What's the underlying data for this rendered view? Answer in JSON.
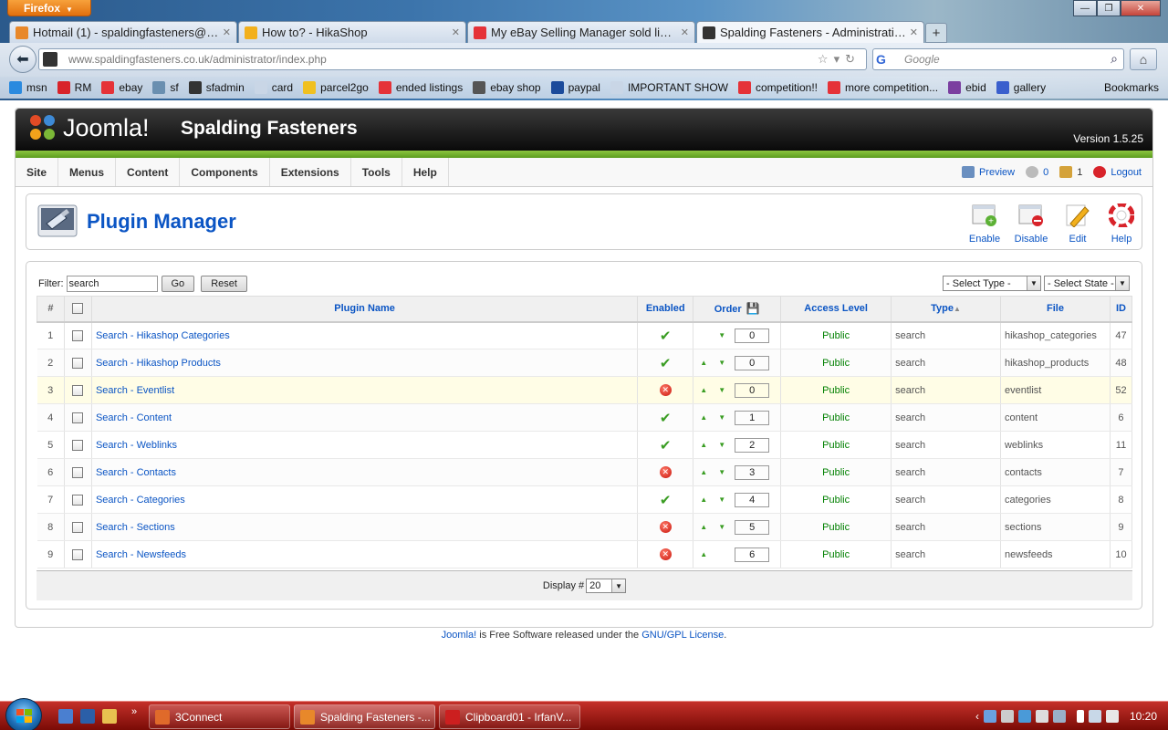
{
  "browser": {
    "app_button": "Firefox",
    "tabs": [
      {
        "title": "Hotmail (1) - spaldingfasteners@hot...",
        "icon_color": "#e8882a",
        "active": false
      },
      {
        "title": "How to? - HikaShop",
        "icon_color": "#f2b01c",
        "active": false
      },
      {
        "title": "My eBay Selling Manager sold listings...",
        "icon_color": "#e53238",
        "active": false
      },
      {
        "title": "Spalding Fasteners - Administration",
        "icon_color": "#333333",
        "active": true
      }
    ],
    "url_host": "www.spaldingfasteners.co.uk",
    "url_path": "/administrator/index.php",
    "search_engine_icon": "G",
    "search_placeholder": "Google",
    "bookmarks": [
      {
        "label": "msn",
        "icon_color": "#2a8adf"
      },
      {
        "label": "RM",
        "icon_color": "#d8232a"
      },
      {
        "label": "ebay",
        "icon_color": "#e53238"
      },
      {
        "label": "sf",
        "icon_color": "#6a8fb0"
      },
      {
        "label": "sfadmin",
        "icon_color": "#333333"
      },
      {
        "label": "card",
        "icon_color": "#c9d6e6"
      },
      {
        "label": "parcel2go",
        "icon_color": "#f0c020"
      },
      {
        "label": "ended listings",
        "icon_color": "#e53238"
      },
      {
        "label": "ebay shop",
        "icon_color": "#555555"
      },
      {
        "label": "paypal",
        "icon_color": "#1c4b9b"
      },
      {
        "label": "IMPORTANT SHOW",
        "icon_color": "#c9d6e6"
      },
      {
        "label": "competition!!",
        "icon_color": "#e53238"
      },
      {
        "label": "more competition...",
        "icon_color": "#e53238"
      },
      {
        "label": "ebid",
        "icon_color": "#7b3fa0"
      },
      {
        "label": "gallery",
        "icon_color": "#3a5fcd"
      }
    ],
    "bookmarks_menu": "Bookmarks"
  },
  "joomla": {
    "logo_text": "Joomla!",
    "site_name": "Spalding Fasteners",
    "version": "Version 1.5.25",
    "menu": [
      "Site",
      "Menus",
      "Content",
      "Components",
      "Extensions",
      "Tools",
      "Help"
    ],
    "status": {
      "preview": "Preview",
      "messages": "0",
      "users": "1",
      "logout": "Logout"
    },
    "page_title": "Plugin Manager",
    "toolbar": {
      "enable": "Enable",
      "disable": "Disable",
      "edit": "Edit",
      "help": "Help"
    },
    "filter": {
      "label": "Filter:",
      "value": "search",
      "go": "Go",
      "reset": "Reset",
      "type_select": "- Select Type -",
      "state_select": "- Select State -"
    },
    "table": {
      "headers": {
        "num": "#",
        "name": "Plugin Name",
        "enabled": "Enabled",
        "order": "Order",
        "access": "Access Level",
        "type": "Type",
        "file": "File",
        "id": "ID"
      },
      "rows": [
        {
          "num": "1",
          "name": "Search - Hikashop Categories",
          "enabled": true,
          "up": false,
          "down": true,
          "order": "0",
          "access": "Public",
          "type": "search",
          "file": "hikashop_categories",
          "id": "47"
        },
        {
          "num": "2",
          "name": "Search - Hikashop Products",
          "enabled": true,
          "up": true,
          "down": true,
          "order": "0",
          "access": "Public",
          "type": "search",
          "file": "hikashop_products",
          "id": "48"
        },
        {
          "num": "3",
          "name": "Search - Eventlist",
          "enabled": false,
          "up": true,
          "down": true,
          "order": "0",
          "access": "Public",
          "type": "search",
          "file": "eventlist",
          "id": "52"
        },
        {
          "num": "4",
          "name": "Search - Content",
          "enabled": true,
          "up": true,
          "down": true,
          "order": "1",
          "access": "Public",
          "type": "search",
          "file": "content",
          "id": "6"
        },
        {
          "num": "5",
          "name": "Search - Weblinks",
          "enabled": true,
          "up": true,
          "down": true,
          "order": "2",
          "access": "Public",
          "type": "search",
          "file": "weblinks",
          "id": "11"
        },
        {
          "num": "6",
          "name": "Search - Contacts",
          "enabled": false,
          "up": true,
          "down": true,
          "order": "3",
          "access": "Public",
          "type": "search",
          "file": "contacts",
          "id": "7"
        },
        {
          "num": "7",
          "name": "Search - Categories",
          "enabled": true,
          "up": true,
          "down": true,
          "order": "4",
          "access": "Public",
          "type": "search",
          "file": "categories",
          "id": "8"
        },
        {
          "num": "8",
          "name": "Search - Sections",
          "enabled": false,
          "up": true,
          "down": true,
          "order": "5",
          "access": "Public",
          "type": "search",
          "file": "sections",
          "id": "9"
        },
        {
          "num": "9",
          "name": "Search - Newsfeeds",
          "enabled": false,
          "up": true,
          "down": false,
          "order": "6",
          "access": "Public",
          "type": "search",
          "file": "newsfeeds",
          "id": "10"
        }
      ]
    },
    "display_label": "Display #",
    "display_value": "20",
    "footer": {
      "joomla_link": "Joomla!",
      "middle": " is Free Software released under the ",
      "license_link": "GNU/GPL License",
      "end": "."
    },
    "colors": {
      "link_blue": "#0b55c4",
      "green": "#008000",
      "header_green": "#8cc63f"
    }
  },
  "taskbar": {
    "tasks": [
      {
        "label": "3Connect",
        "icon_color": "#e06a2a",
        "active": false
      },
      {
        "label": "Spalding Fasteners -...",
        "icon_color": "#e8882a",
        "active": true
      },
      {
        "label": "Clipboard01 - IrfanV...",
        "icon_color": "#cc1f1f",
        "active": false
      }
    ],
    "more": "»",
    "clock": "10:20"
  }
}
